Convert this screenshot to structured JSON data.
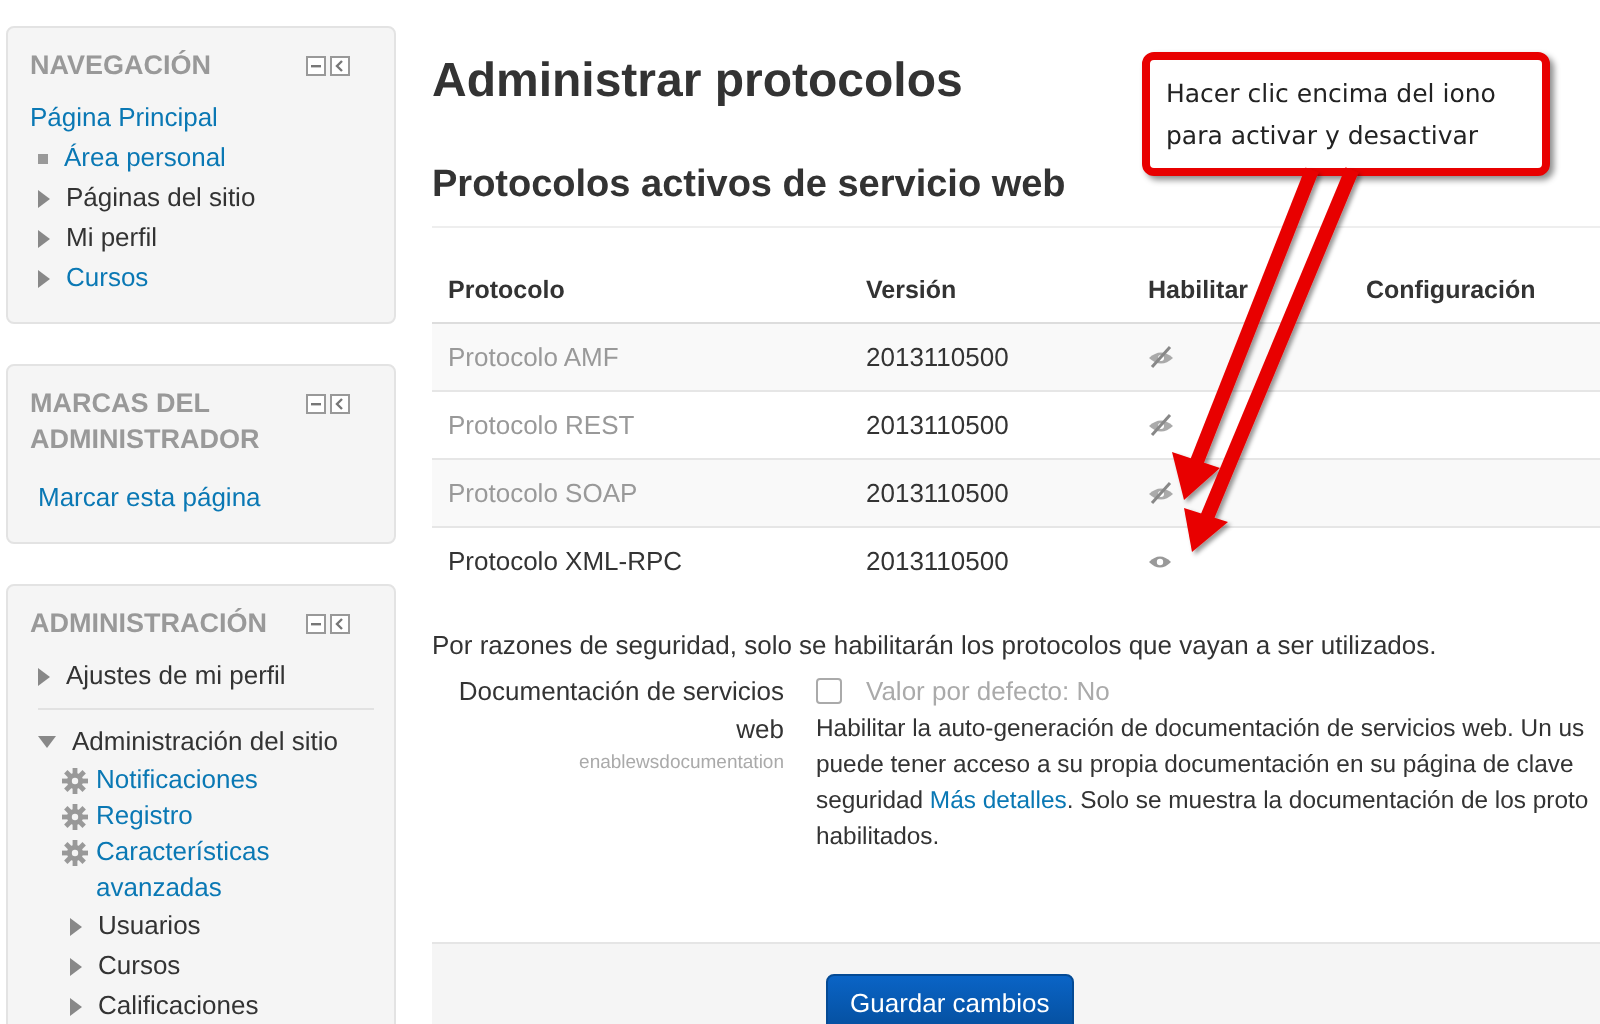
{
  "sidebar": {
    "blocks": [
      {
        "title": "NAVEGACIÓN",
        "items": [
          {
            "label": "Página Principal",
            "kind": "root",
            "link": true,
            "children": [
              {
                "label": "Área personal",
                "kind": "bullet",
                "link": true
              },
              {
                "label": "Páginas del sitio",
                "kind": "branch",
                "link": false,
                "expanded": false
              },
              {
                "label": "Mi perfil",
                "kind": "branch",
                "link": false,
                "expanded": false
              },
              {
                "label": "Cursos",
                "kind": "branch",
                "link": true,
                "expanded": false
              }
            ]
          }
        ]
      },
      {
        "title": "MARCAS DEL ADMINISTRADOR",
        "items": [
          {
            "label": "Marcar esta página",
            "kind": "plain",
            "link": true
          }
        ]
      },
      {
        "title": "ADMINISTRACIÓN",
        "items": [
          {
            "label": "Ajustes de mi perfil",
            "kind": "branch",
            "link": false,
            "expanded": false
          },
          {
            "label": "Administración del sitio",
            "kind": "branch",
            "link": false,
            "expanded": true,
            "children": [
              {
                "label": "Notificaciones",
                "kind": "gear",
                "link": true
              },
              {
                "label": "Registro",
                "kind": "gear",
                "link": true
              },
              {
                "label": "Características avanzadas",
                "kind": "gear",
                "link": true
              },
              {
                "label": "Usuarios",
                "kind": "branch",
                "link": false,
                "expanded": false
              },
              {
                "label": "Cursos",
                "kind": "branch",
                "link": false,
                "expanded": false
              },
              {
                "label": "Calificaciones",
                "kind": "branch",
                "link": false,
                "expanded": false
              }
            ]
          }
        ]
      }
    ]
  },
  "page_title": "Administrar protocolos",
  "section_title": "Protocolos activos de servicio web",
  "table": {
    "columns": [
      "Protocolo",
      "Versión",
      "Habilitar",
      "Configuración"
    ],
    "rows": [
      {
        "protocol": "Protocolo AMF",
        "version": "2013110500",
        "enabled": false
      },
      {
        "protocol": "Protocolo REST",
        "version": "2013110500",
        "enabled": false
      },
      {
        "protocol": "Protocolo SOAP",
        "version": "2013110500",
        "enabled": false
      },
      {
        "protocol": "Protocolo XML-RPC",
        "version": "2013110500",
        "enabled": true
      }
    ]
  },
  "security_note": "Por razones de seguridad, solo se habilitarán los protocolos que vayan a ser utilizados.",
  "setting": {
    "label": "Documentación de servicios web",
    "name": "enablewsdocumentation",
    "checked": false,
    "default": "Valor por defecto: No",
    "description": [
      [
        {
          "kind": "text",
          "text": "Habilitar la auto-generación de documentación de servicios web. Un us"
        }
      ],
      [
        {
          "kind": "text",
          "text": "puede tener acceso a su propia documentación en su página de clave"
        }
      ],
      [
        {
          "kind": "text",
          "text": "seguridad "
        },
        {
          "kind": "link",
          "text": "Más detalles"
        },
        {
          "kind": "text",
          "text": ". Solo se muestra la documentación de los proto"
        }
      ],
      [
        {
          "kind": "text",
          "text": "habilitados."
        }
      ]
    ]
  },
  "save_button": "Guardar cambios",
  "callout": {
    "text": "Hacer clic encima del iono para activar y desactivar"
  }
}
